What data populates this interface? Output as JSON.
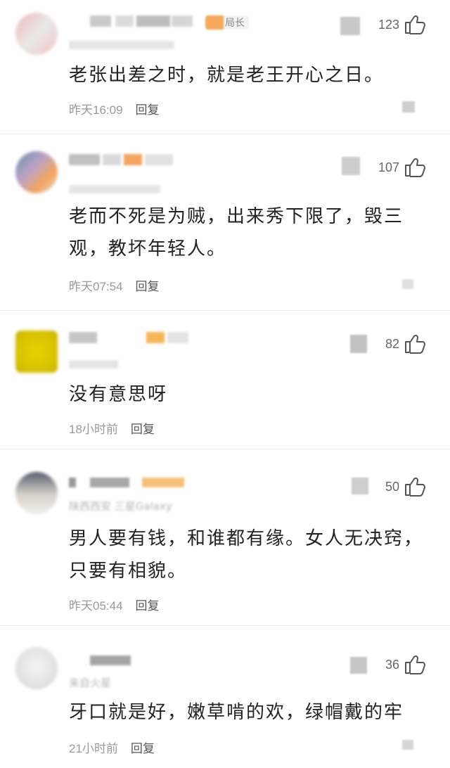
{
  "comments": [
    {
      "badge": "局长",
      "likes": "123",
      "text": "老张出差之时，就是老王开心之日。",
      "time": "昨天16:09",
      "reply": "回复"
    },
    {
      "likes": "107",
      "text": "老而不死是为贼，出来秀下限了，毁三观，教坏年轻人。",
      "time": "昨天07:54",
      "reply": "回复"
    },
    {
      "likes": "82",
      "text": "没有意思呀",
      "time": "18小时前",
      "reply": "回复"
    },
    {
      "likes": "50",
      "location": "陕西西安  三星Galaxy",
      "text": "男人要有钱，和谁都有缘。女人无决窍，只要有相貌。",
      "time": "昨天05:44",
      "reply": "回复"
    },
    {
      "likes": "36",
      "location": "来自火星",
      "text": "牙口就是好，嫩草啃的欢，绿帽戴的牢",
      "time": "21小时前",
      "reply": "回复"
    }
  ],
  "colors": {
    "accent": "#f7a85a",
    "text": "#222222",
    "meta": "#999999",
    "icon": "#555555"
  },
  "icons": {
    "like": "thumbs-up-icon"
  }
}
